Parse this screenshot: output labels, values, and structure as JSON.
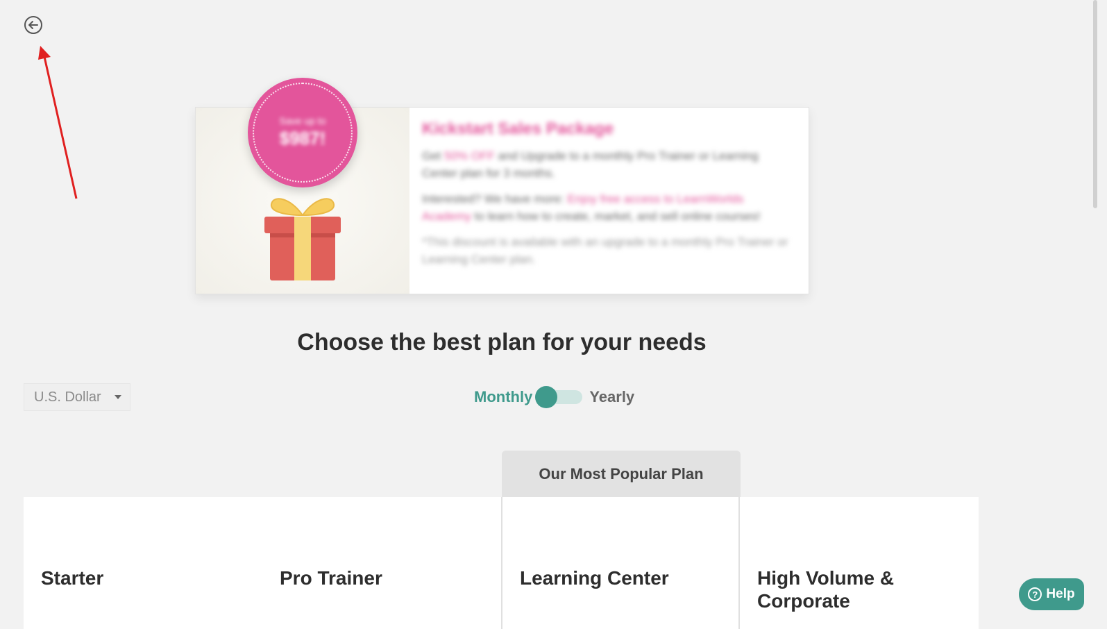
{
  "nav": {
    "back_icon": "arrow-left-circle-icon"
  },
  "promo": {
    "badge_line1": "Save up to",
    "badge_line2": "$987!",
    "gift_icon": "gift-icon",
    "title": "Kickstart Sales Package",
    "p1_pre": "Get ",
    "p1_highlight": "50% OFF",
    "p1_post": " and Upgrade to a monthly Pro Trainer or Learning Center plan for 3 months.",
    "p2_pre": "Interested? We have more: ",
    "p2_highlight": "Enjoy free access to LearnWorlds Academy",
    "p2_post": " to learn how to create, market, and sell online courses!",
    "note": "*This discount is available with an upgrade to a monthly Pro Trainer or Learning Center plan."
  },
  "page_title": "Choose the best plan for your needs",
  "currency": {
    "selected": "U.S. Dollar"
  },
  "billing": {
    "monthly_label": "Monthly",
    "yearly_label": "Yearly",
    "selected": "Monthly"
  },
  "popular_label": "Our Most Popular Plan",
  "plans": [
    {
      "name": "Starter"
    },
    {
      "name": "Pro Trainer"
    },
    {
      "name": "Learning Center"
    },
    {
      "name": "High Volume & Corporate"
    }
  ],
  "help": {
    "label": "Help",
    "icon": "question-circle-icon"
  },
  "colors": {
    "accent": "#3f9a8c",
    "promo_pink": "#e3559b",
    "annotation_red": "#e02020"
  }
}
